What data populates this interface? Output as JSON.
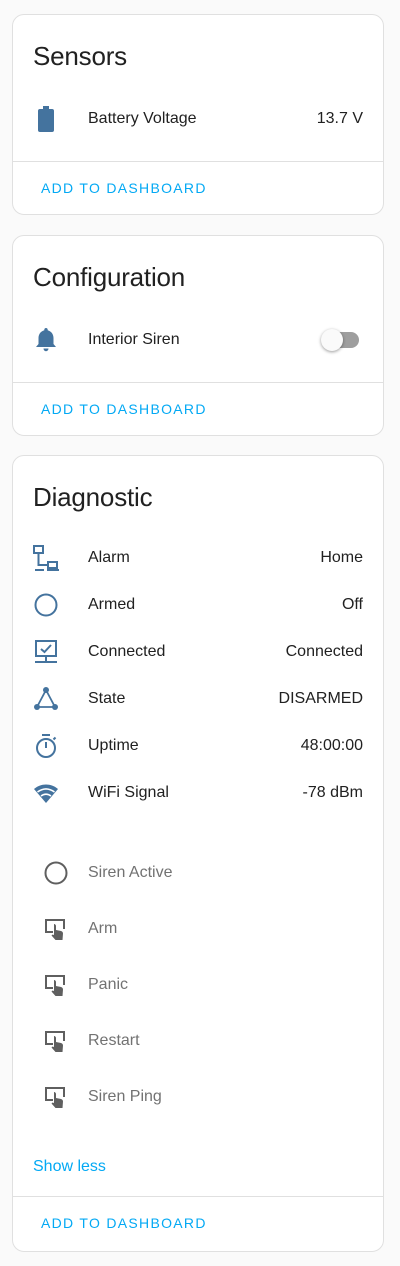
{
  "colors": {
    "accent": "#03a9f4",
    "icon": "#44739e",
    "muted_icon": "#5f5f5f"
  },
  "sensors": {
    "title": "Sensors",
    "items": [
      {
        "icon": "battery-icon",
        "label": "Battery Voltage",
        "value": "13.7 V"
      }
    ],
    "action": "ADD TO DASHBOARD"
  },
  "configuration": {
    "title": "Configuration",
    "items": [
      {
        "icon": "bell-icon",
        "label": "Interior Siren",
        "state": "off"
      }
    ],
    "action": "ADD TO DASHBOARD"
  },
  "diagnostic": {
    "title": "Diagnostic",
    "items": [
      {
        "icon": "lan-icon",
        "label": "Alarm",
        "value": "Home"
      },
      {
        "icon": "circle-outline-icon",
        "label": "Armed",
        "value": "Off"
      },
      {
        "icon": "monitor-check-icon",
        "label": "Connected",
        "value": "Connected"
      },
      {
        "icon": "state-machine-icon",
        "label": "State",
        "value": "DISARMED"
      },
      {
        "icon": "timer-icon",
        "label": "Uptime",
        "value": "48:00:00"
      },
      {
        "icon": "wifi-icon",
        "label": "WiFi Signal",
        "value": "-78 dBm"
      }
    ],
    "hidden_items": [
      {
        "icon": "circle-outline-icon",
        "label": "Siren Active"
      },
      {
        "icon": "gesture-tap-button-icon",
        "label": "Arm"
      },
      {
        "icon": "gesture-tap-button-icon",
        "label": "Panic"
      },
      {
        "icon": "gesture-tap-button-icon",
        "label": "Restart"
      },
      {
        "icon": "gesture-tap-button-icon",
        "label": "Siren Ping"
      }
    ],
    "show_less": "Show less",
    "action": "ADD TO DASHBOARD"
  }
}
